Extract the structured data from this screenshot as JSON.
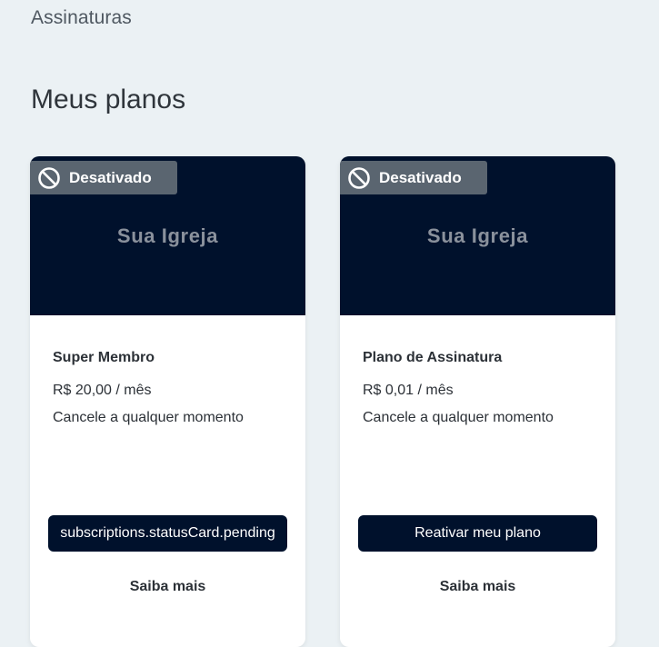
{
  "breadcrumb": "Assinaturas",
  "page_title": "Meus planos",
  "cards": [
    {
      "status_label": "Desativado",
      "status_icon": "ban-icon",
      "banner_text": "Sua Igreja",
      "plan_name": "Super Membro",
      "price": "R$ 20,00 / mês",
      "note": "Cancele a qualquer momento",
      "primary_button": "subscriptions.statusCard.pending",
      "secondary_link": "Saiba mais"
    },
    {
      "status_label": "Desativado",
      "status_icon": "ban-icon",
      "banner_text": "Sua Igreja",
      "plan_name": "Plano de Assinatura",
      "price": "R$ 0,01 / mês",
      "note": "Cancele a qualquer momento",
      "primary_button": "Reativar meu plano",
      "secondary_link": "Saiba mais"
    }
  ],
  "colors": {
    "background": "#ebf1f4",
    "banner": "#00112c",
    "badge": "#5a6570",
    "button": "#00112c"
  }
}
